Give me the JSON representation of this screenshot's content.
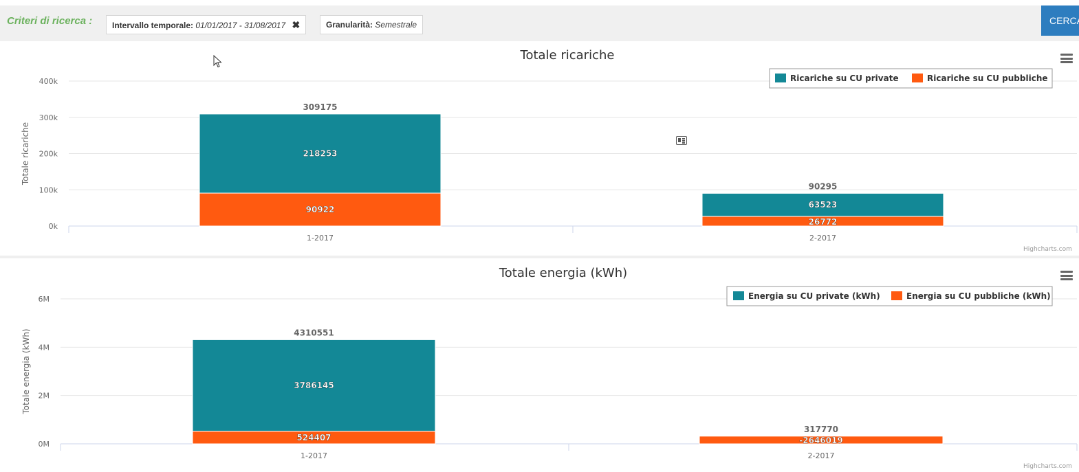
{
  "filters": {
    "label": "Criteri di ricerca  :",
    "time_range": {
      "label": "Intervallo temporale:",
      "value": "01/01/2017 - 31/08/2017",
      "remove": "✖"
    },
    "granularity": {
      "label": "Granularità:",
      "value": "Semestrale"
    },
    "search_button": "CERCA"
  },
  "credits": "Highcharts.com",
  "colors": {
    "private": "#138896",
    "public": "#ff5a10",
    "green_label": "#6cb25e",
    "button": "#2d7dbf"
  },
  "chart_data": [
    {
      "type": "bar",
      "stacked": true,
      "title": "Totale ricariche",
      "xlabel": "",
      "ylabel": "Totale ricariche",
      "categories": [
        "1-2017",
        "2-2017"
      ],
      "ylim": [
        0,
        400000
      ],
      "yticks": [
        0,
        100000,
        200000,
        300000,
        400000
      ],
      "ytick_labels": [
        "0k",
        "100k",
        "200k",
        "300k",
        "400k"
      ],
      "series": [
        {
          "name": "Ricariche su CU private",
          "color": "#138896",
          "values": [
            218253,
            63523
          ]
        },
        {
          "name": "Ricariche su CU pubbliche",
          "color": "#ff5a10",
          "values": [
            90922,
            26772
          ]
        }
      ],
      "totals": [
        309175,
        90295
      ],
      "legend": "top-right",
      "grid": true
    },
    {
      "type": "bar",
      "stacked": true,
      "title": "Totale energia (kWh)",
      "xlabel": "",
      "ylabel": "Totale energia (kWh)",
      "categories": [
        "1-2017",
        "2-2017"
      ],
      "ylim": [
        0,
        6000000
      ],
      "yticks": [
        0,
        2000000,
        4000000,
        6000000
      ],
      "ytick_labels": [
        "0M",
        "2M",
        "4M",
        "6M"
      ],
      "series": [
        {
          "name": "Energia su CU private (kWh)",
          "color": "#138896",
          "values": [
            3786145,
            -2646019
          ]
        },
        {
          "name": "Energia su CU pubbliche (kWh)",
          "color": "#ff5a10",
          "values": [
            524407,
            317770
          ]
        }
      ],
      "totals": [
        4310551,
        317770
      ],
      "legend": "top-right",
      "grid": true
    }
  ]
}
